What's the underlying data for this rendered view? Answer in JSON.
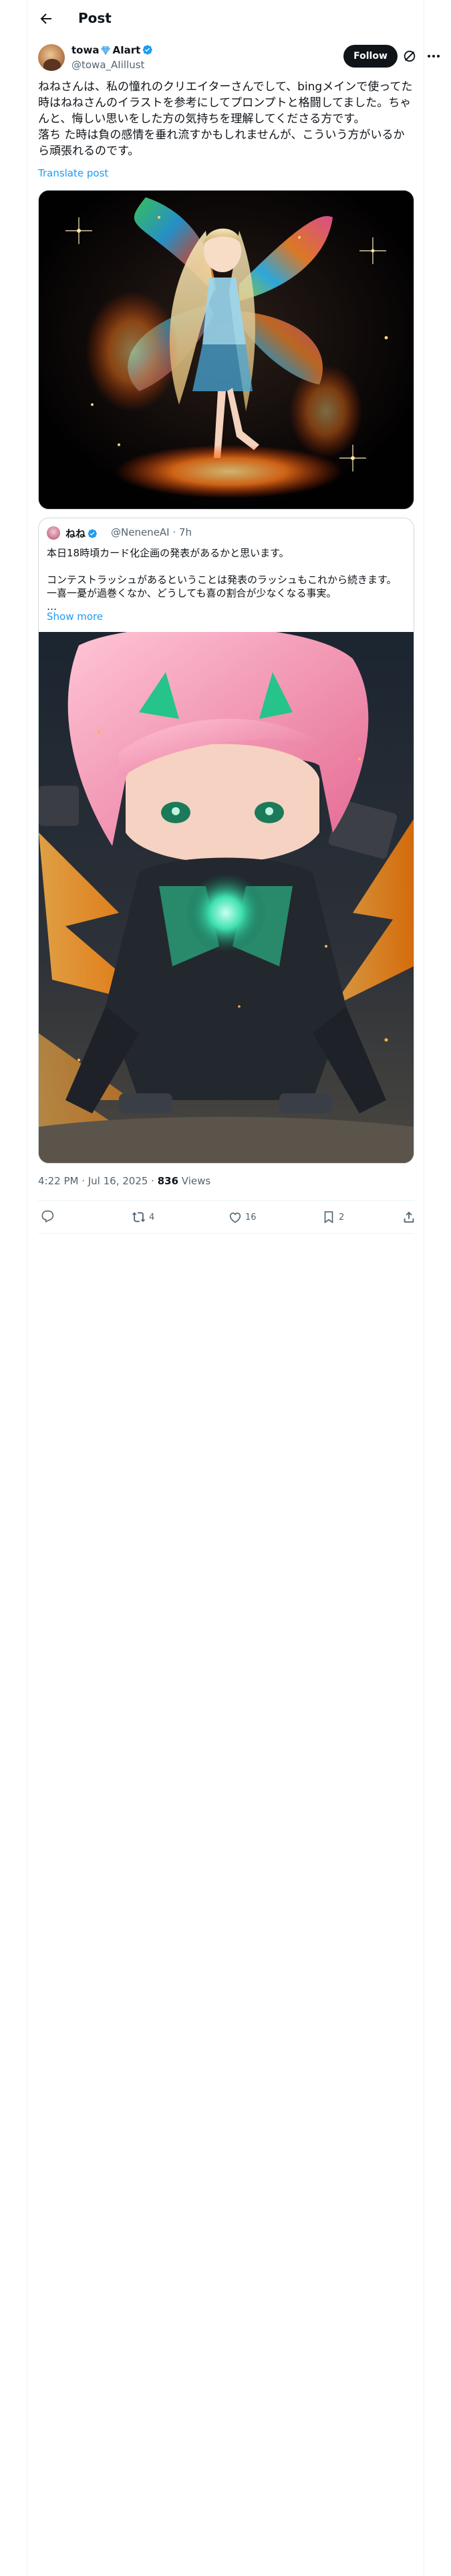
{
  "header": {
    "title": "Post"
  },
  "author": {
    "name": "towa",
    "name_suffix": "AIart",
    "handle": "@towa_AIillust"
  },
  "follow_label": "Follow",
  "post": {
    "text": "ねねさんは、私の憧れのクリエイターさんでして、bingメインで使ってた時はねねさんのイラストを参考にしてプロンプトと格闘してました。ちゃんと、悔しい思いをした方の気持ちを理解してくださる方です。\n落ち た時は負の感情を垂れ流すかもしれませんが、こういう方がいるから頑張れるのです。",
    "translate": "Translate post"
  },
  "quote": {
    "name": "ねね",
    "handle": "@NeneneAI",
    "sep": " · ",
    "time": "7h",
    "text": "本日18時頃カード化企画の発表があるかと思います。\n\nコンテストラッシュがあるということは発表のラッシュもこれから続きます。\n一喜一憂が過巻くなか、どうしても喜の割合が少なくなる事実。\n…",
    "show_more": "Show more"
  },
  "meta": {
    "time": "4:22 PM · Jul 16, 2025 · ",
    "views_count": "836",
    "views_label": " Views"
  },
  "actions": {
    "retweets": "4",
    "likes": "16",
    "bookmarks": "2"
  },
  "colors": {
    "accent": "#1d9bf0",
    "verified": "#1d9bf0",
    "text": "#0f1419",
    "secondary": "#536471"
  }
}
